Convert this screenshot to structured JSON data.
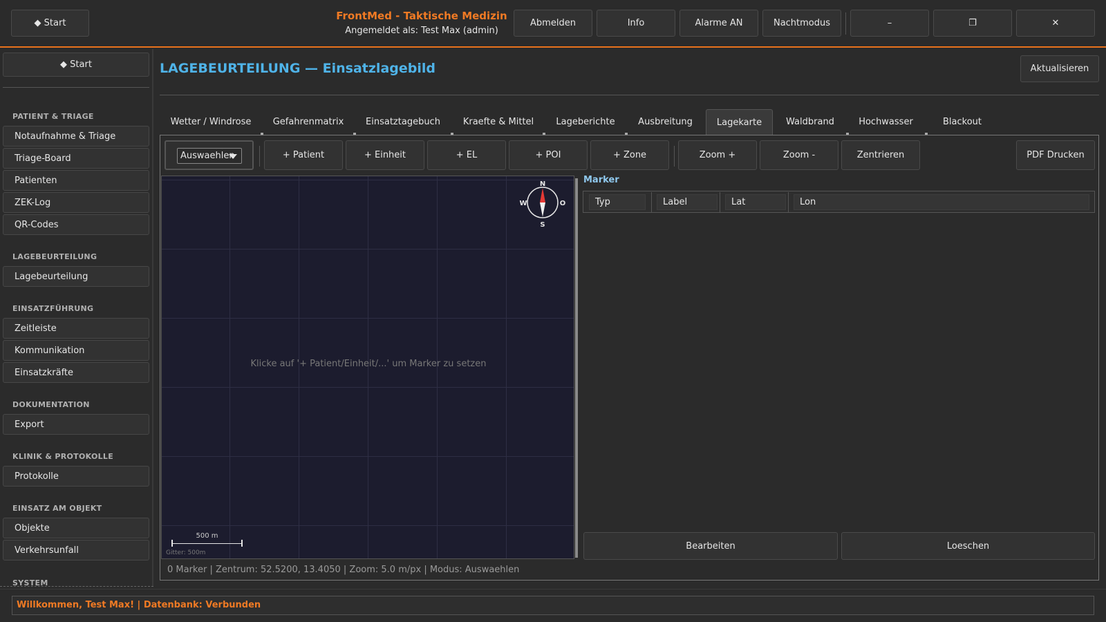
{
  "header": {
    "start_label": "◆  Start",
    "app_title": "FrontMed - Taktische Medizin",
    "login_info": "Angemeldet als: Test Max (admin)",
    "buttons": {
      "logout": "Abmelden",
      "info": "Info",
      "alarms": "Alarme AN",
      "night_mode": "Nachtmodus",
      "minimize": "–",
      "maximize": "❐",
      "close": "✕"
    }
  },
  "sidebar": {
    "start_label": "◆  Start",
    "sections": [
      {
        "title": "PATIENT & TRIAGE",
        "items": [
          "Notaufnahme & Triage",
          "Triage-Board",
          "Patienten",
          "ZEK-Log",
          "QR-Codes"
        ]
      },
      {
        "title": "LAGEBEURTEILUNG",
        "items": [
          "Lagebeurteilung"
        ]
      },
      {
        "title": "EINSATZFÜHRUNG",
        "items": [
          "Zeitleiste",
          "Kommunikation",
          "Einsatzkräfte"
        ]
      },
      {
        "title": "DOKUMENTATION",
        "items": [
          "Export"
        ]
      },
      {
        "title": "KLINIK & PROTOKOLLE",
        "items": [
          "Protokolle"
        ]
      },
      {
        "title": "EINSATZ AM OBJEKT",
        "items": [
          "Objekte",
          "Verkehrsunfall"
        ]
      },
      {
        "title": "SYSTEM",
        "items": []
      }
    ]
  },
  "main": {
    "title": "LAGEBEURTEILUNG — Einsatzlagebild",
    "refresh_label": "Aktualisieren",
    "tabs": [
      "Wetter / Windrose",
      "Gefahrenmatrix",
      "Einsatztagebuch",
      "Kraefte & Mittel",
      "Lageberichte",
      "Ausbreitung",
      "Lagekarte",
      "Waldbrand",
      "Hochwasser",
      "Blackout"
    ],
    "active_tab": "Lagekarte"
  },
  "toolbar": {
    "mode_value": "Auswaehlen",
    "add_patient": "+ Patient",
    "add_unit": "+ Einheit",
    "add_el": "+ EL",
    "add_poi": "+ POI",
    "add_zone": "+ Zone",
    "zoom_in": "Zoom +",
    "zoom_out": "Zoom -",
    "center": "Zentrieren",
    "pdf_print": "PDF Drucken"
  },
  "map": {
    "hint": "Klicke auf '+ Patient/Einheit/...' um Marker zu setzen",
    "scale_label": "500 m",
    "grid_label": "Gitter: 500m",
    "compass": {
      "n": "N",
      "s": "S",
      "w": "W",
      "o": "O"
    },
    "status": "0 Marker | Zentrum: 52.5200, 13.4050 | Zoom: 5.0 m/px | Modus: Auswaehlen"
  },
  "markers": {
    "title": "Marker",
    "columns": [
      "Typ",
      "Label",
      "Lat",
      "Lon"
    ],
    "rows": [],
    "edit_label": "Bearbeiten",
    "delete_label": "Loeschen"
  },
  "footer": {
    "status": "Willkommen, Test Max! | Datenbank: Verbunden"
  },
  "colors": {
    "accent": "#f07a24",
    "title_blue": "#4fb3e8",
    "background": "#2b2b2b",
    "map_background": "#1c1c2e"
  }
}
